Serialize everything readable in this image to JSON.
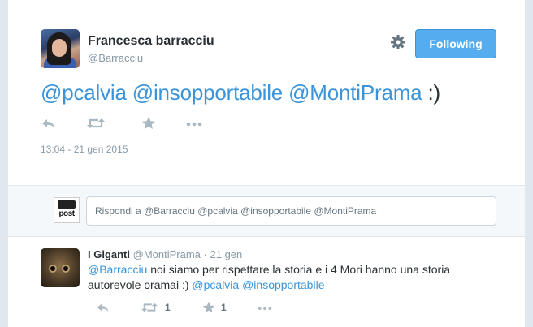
{
  "main_tweet": {
    "fullname": "Francesca barracciu",
    "username": "@Barracciu",
    "follow_label": "Following",
    "text_mentions": [
      "@pcalvia",
      "@insopportabile",
      "@MontiPrama"
    ],
    "text_tail": ":)",
    "timestamp": "13:04 - 21 gen 2015",
    "icons": [
      "reply-icon",
      "retweet-icon",
      "favorite-icon",
      "more-icon",
      "gear-icon"
    ]
  },
  "reply_bar": {
    "placeholder": "Rispondi a @Barracciu @pcalvia @insopportabile @MontiPrama",
    "avatar_text": "post"
  },
  "reply_tweet": {
    "fullname": "I Giganti",
    "username": "@MontiPrama",
    "separator": "·",
    "date": "21 gen",
    "mention_1": "@Barracciu",
    "text_1": " noi siamo per rispettare la storia e i 4 Mori hanno una storia autorevole oramai :) ",
    "mention_2": "@pcalvia",
    "mention_3": "@insopportabile",
    "retweet_count": "1",
    "favorite_count": "1"
  },
  "colors": {
    "accent": "#55acee",
    "link": "#3b94d9",
    "text": "#292f33",
    "muted": "#8899a6"
  }
}
